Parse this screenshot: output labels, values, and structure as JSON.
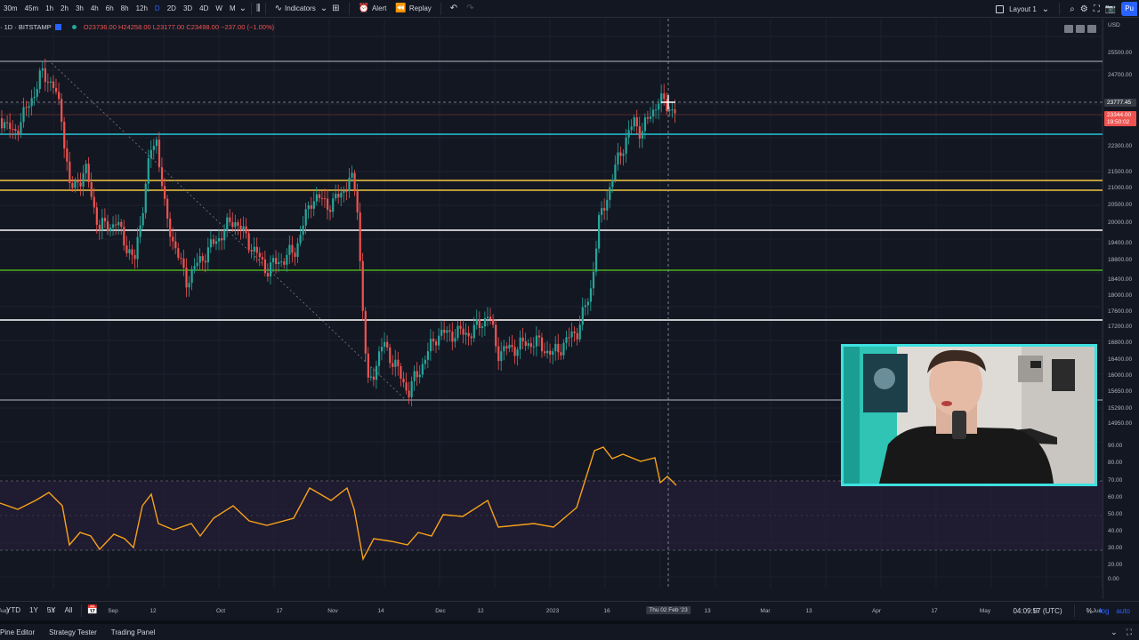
{
  "toolbar": {
    "timeframes": [
      "30m",
      "45m",
      "1h",
      "2h",
      "3h",
      "4h",
      "6h",
      "8h",
      "12h",
      "D",
      "2D",
      "3D",
      "4D",
      "W",
      "M"
    ],
    "active_timeframe": "D",
    "indicators_label": "Indicators",
    "alert_label": "Alert",
    "replay_label": "Replay",
    "layout_label": "Layout 1",
    "publish_label": "Pu"
  },
  "legend": {
    "symbol": "· 1D · BITSTAMP",
    "ohlc": "O23736.00 H24258.00 L23177.00 C23498.00 −237.00 (−1.00%)"
  },
  "price_axis": {
    "currency": "USD",
    "labels": [
      "25500.00",
      "24700.00",
      "22300.00",
      "21500.00",
      "21000.00",
      "20500.00",
      "20000.00",
      "19400.00",
      "18800.00",
      "18400.00",
      "18000.00",
      "17600.00",
      "17200.00",
      "16800.00",
      "16400.00",
      "16000.00",
      "15650.00",
      "15290.00",
      "14950.00"
    ],
    "crosshair_price": "23777.45",
    "last_price": "23344.00",
    "countdown": "19:50:02",
    "rsi_labels": [
      "90.00",
      "80.00",
      "70.00",
      "60.00",
      "50.00",
      "40.00",
      "30.00",
      "20.00",
      "0.00"
    ]
  },
  "time_axis": {
    "labels": [
      "Aug",
      "15",
      "Sep",
      "12",
      "Oct",
      "17",
      "Nov",
      "14",
      "Dec",
      "12",
      "2023",
      "16",
      "13",
      "Mar",
      "13",
      "Apr",
      "17",
      "May",
      "15",
      "Jun"
    ],
    "crosshair_date": "Thu 02 Feb '23"
  },
  "range_bar": {
    "ranges": [
      "YTD",
      "1Y",
      "5Y",
      "All"
    ],
    "clock": "04:09:57 (UTC)",
    "percent": "%",
    "log": "log",
    "auto": "auto"
  },
  "panel_tabs": [
    "Pine Editor",
    "Strategy Tester",
    "Trading Panel"
  ],
  "colors": {
    "background": "#131722",
    "up": "#26a69a",
    "down": "#ef5350",
    "cyan_level": "#26c6da",
    "yellow_level": "#f5c542",
    "green_level": "#4caf1a",
    "white_level": "#ffffff",
    "rsi_line": "#f7a21b",
    "rsi_band": "#2a1f3d",
    "webcam_border": "#3ee0e0"
  }
}
